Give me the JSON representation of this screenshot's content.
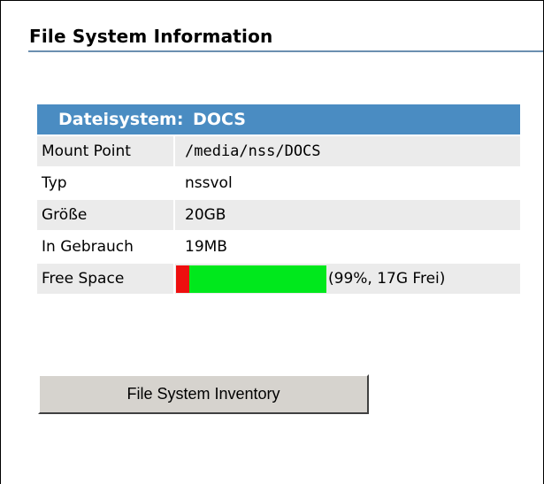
{
  "section": {
    "title": "File System Information"
  },
  "filesystem": {
    "header": "Dateisystem:  DOCS",
    "rows": [
      {
        "label": "Mount Point",
        "value": "/media/nss/DOCS"
      },
      {
        "label": "Typ",
        "value": "nssvol"
      },
      {
        "label": "Größe",
        "value": "20GB"
      },
      {
        "label": "In Gebrauch",
        "value": "19MB"
      }
    ],
    "free_space": {
      "label": "Free Space",
      "used_fraction": 0.01,
      "caption": "(99%, 17G Frei)",
      "used_color": "#ee0f0f",
      "free_color": "#00e81c"
    }
  },
  "actions": {
    "inventory_label": "File System Inventory"
  },
  "colors": {
    "header_bg": "#4a8cc2",
    "row_shade": "#ebebeb",
    "title_rule": "#6b8fb0"
  }
}
